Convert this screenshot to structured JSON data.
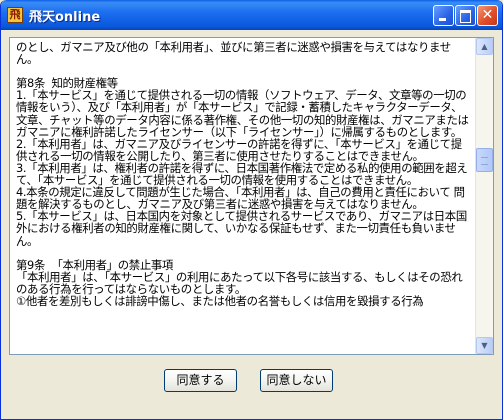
{
  "window": {
    "title": "飛天online",
    "icon": "app-icon"
  },
  "titlebar_buttons": {
    "minimize": "minimize-icon",
    "maximize": "maximize-icon",
    "close_glyph": "✕"
  },
  "agreement": {
    "text": "のとし、ガマニア及び他の「本利用者」、並びに第三者に迷惑や損害を与えてはなりません。\n\n第8条  知的財産権等\n1.「本サービス」を通じて提供される一切の情報（ソフトウェア、データ、文章等の一切の情報をいう）、及び「本利用者」が「本サービス」で記録・蓄積したキャラクターデータ、文章、チャット等のデータ内容に係る著作権、その他一切の知的財産権は、ガマニアまたはガマニアに権利許諾したライセンサー（以下「ライセンサー」）に帰属するものとします。\n2.「本利用者」は、ガマニア及びライセンサーの許諾を得ずに、「本サービス」を通じて提供される一切の情報を公開したり、第三者に使用させたりすることはできません。\n3.「本利用者」は、権利者の許諾を得ずに、日本国著作権法で定める私的使用の範囲を超えて、「本サービス」を通じて提供される一切の情報を使用することはできません。\n4.本条の規定に違反して問題が生じた場合、「本利用者」は、自己の費用と責任において 問題を解決するものとし、ガマニア及び第三者に迷惑や損害を与えてはなりません。\n5.「本サービス」は、日本国内を対象として提供されるサービスであり、ガマニアは日本国外における権利者の知的財産権に関して、いかなる保証もせず、また一切責任も負いません。\n\n第9条  「本利用者」の禁止事項\n「本利用者」は、「本サービス」の利用にあたって以下各号に該当する、もしくはその恐れのある行為を行ってはならないものとします。\n①他者を差別もしくは誹謗中傷し、または他者の名誉もしくは信用を毀損する行為"
  },
  "scrollbar": {
    "up_arrow": "▲",
    "down_arrow": "▼"
  },
  "buttons": {
    "agree": "同意する",
    "disagree": "同意しない"
  }
}
